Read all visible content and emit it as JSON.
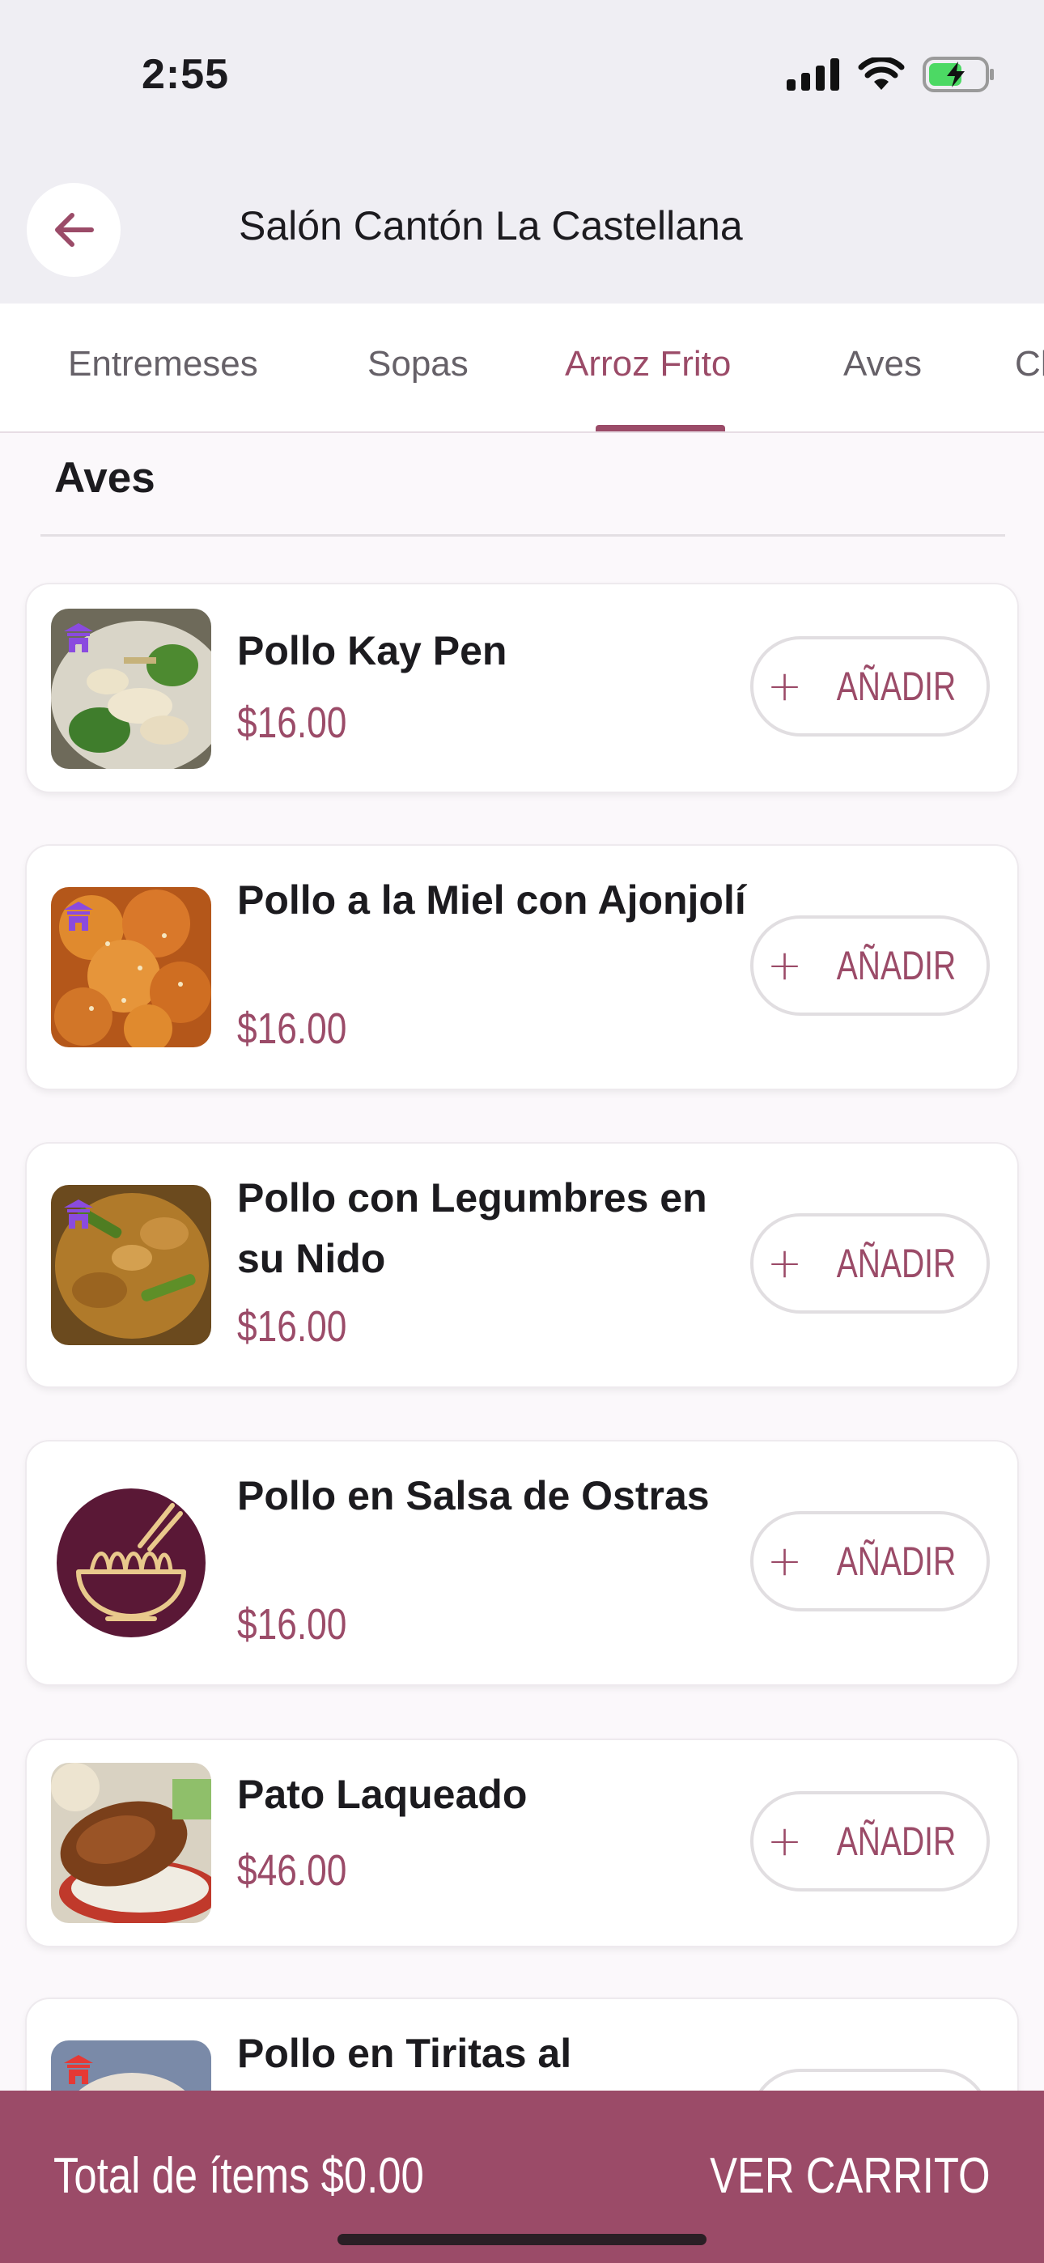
{
  "status": {
    "time": "2:55",
    "icons": [
      "signal-icon",
      "wifi-icon",
      "battery-charging-icon"
    ]
  },
  "header": {
    "back_icon": "arrow-left-icon",
    "title": "Salón Cantón La Castellana"
  },
  "tabs": [
    {
      "label": "Entremeses",
      "active": false
    },
    {
      "label": "Sopas",
      "active": false
    },
    {
      "label": "Arroz Frito",
      "active": true
    },
    {
      "label": "Aves",
      "active": false
    },
    {
      "label": "Ch",
      "active": false
    }
  ],
  "section": {
    "title": "Aves"
  },
  "items": [
    {
      "name": "Pollo Kay Pen",
      "price": "$16.00",
      "add_label": "AÑADIR",
      "image": "chicken-broccoli-photo"
    },
    {
      "name": "Pollo a la Miel con Ajonjolí",
      "price": "$16.00",
      "add_label": "AÑADIR",
      "image": "sesame-chicken-photo"
    },
    {
      "name": "Pollo con Legumbres en su Nido",
      "price": "$16.00",
      "add_label": "AÑADIR",
      "image": "chicken-vegetables-photo"
    },
    {
      "name": "Pollo en Salsa de Ostras",
      "price": "$16.00",
      "add_label": "AÑADIR",
      "image": "noodle-bowl-placeholder"
    },
    {
      "name": "Pato Laqueado",
      "price": "$46.00",
      "add_label": "AÑADIR",
      "image": "roast-duck-photo"
    },
    {
      "name": "Pollo en Tiritas al",
      "price": "",
      "add_label": "",
      "image": "chicken-strips-photo"
    }
  ],
  "footer": {
    "total_label": "Total de ítems $0.00",
    "cart_label": "VER CARRITO"
  },
  "colors": {
    "accent": "#9b4b68",
    "placeholder_bg": "#5a1836",
    "placeholder_icon": "#e9c98c"
  }
}
